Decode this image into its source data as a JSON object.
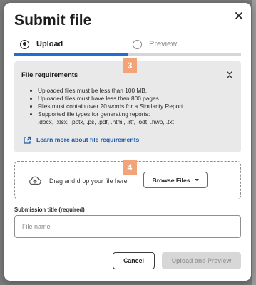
{
  "dialog": {
    "title": "Submit file",
    "close_icon": "close-icon"
  },
  "stepper": {
    "steps": [
      {
        "label": "Upload",
        "active": true
      },
      {
        "label": "Preview",
        "active": false
      }
    ],
    "progress_fraction": 0.5,
    "accent": "#1f6fd1"
  },
  "badges": {
    "requirements": "3",
    "dropzone": "4"
  },
  "requirements": {
    "title": "File requirements",
    "collapse_icon": "chevron-collapse-icon",
    "items": [
      "Uploaded files must be less than 100 MB.",
      "Uploaded files must have less than 800 pages.",
      "Files must contain over 20 words for a Similarity Report.",
      "Supported file types for generating reports:"
    ],
    "file_types": ".docx, .xlsx, .pptx, .ps, .pdf, .html, .rtf, .odt, .hwp, .txt",
    "learn_more": "Learn more about file requirements",
    "learn_more_icon": "external-link-icon"
  },
  "dropzone": {
    "icon": "cloud-upload-icon",
    "text": "Drag and drop your file here",
    "browse_label": "Browse Files"
  },
  "submission_title": {
    "label": "Submission title (required)",
    "placeholder": "File name",
    "value": ""
  },
  "footer": {
    "cancel_label": "Cancel",
    "upload_label": "Upload and Preview"
  }
}
